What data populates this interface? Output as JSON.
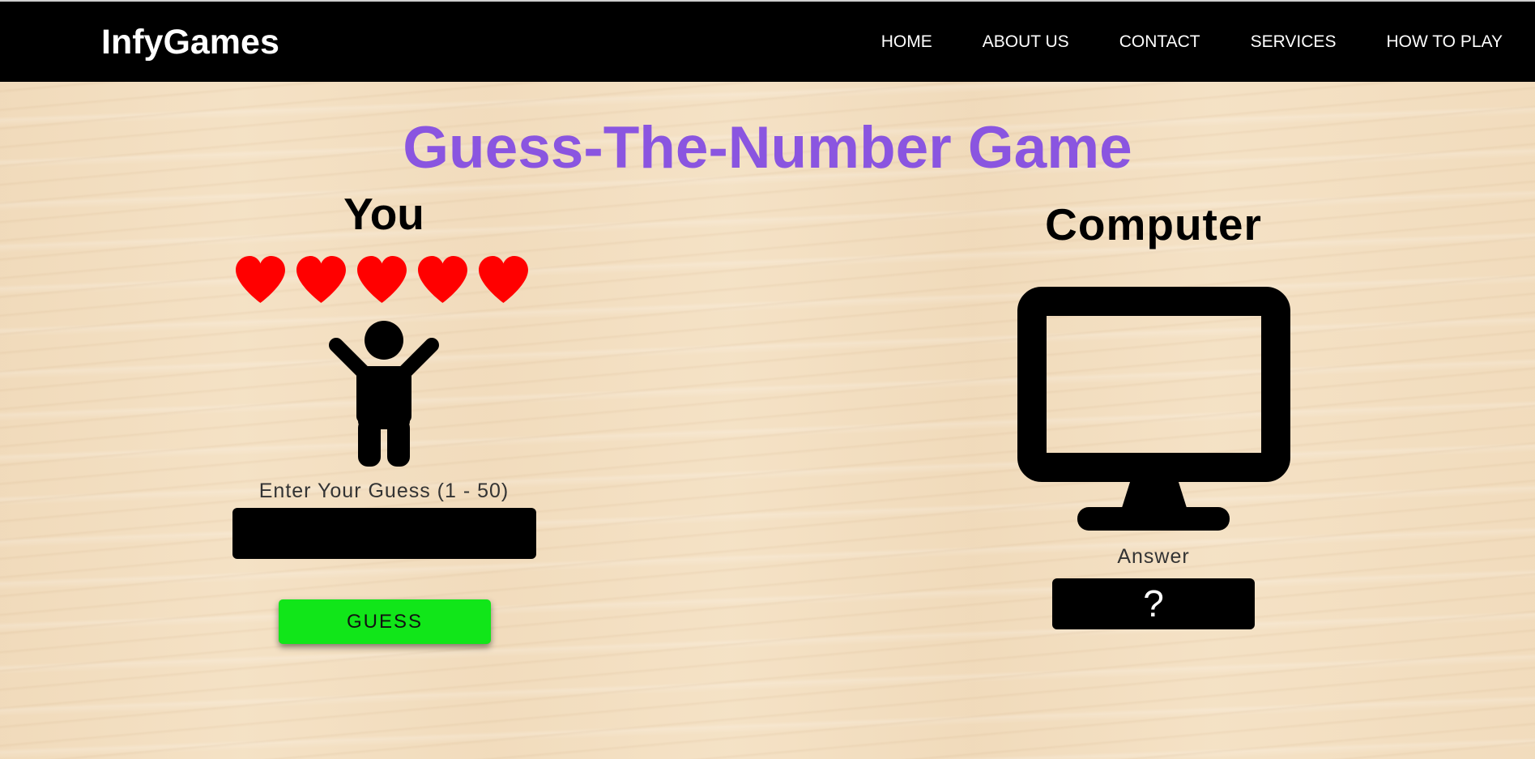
{
  "navbar": {
    "brand": "InfyGames",
    "links": [
      "HOME",
      "ABOUT US",
      "CONTACT",
      "SERVICES",
      "HOW TO PLAY"
    ]
  },
  "title": "Guess-The-Number Game",
  "player": {
    "label": "You",
    "lives": 5,
    "guess_label": "Enter Your Guess (1 - 50)",
    "guess_value": "",
    "guess_button": "GUESS"
  },
  "computer": {
    "label": "Computer",
    "answer_label": "Answer",
    "answer_value": "?"
  },
  "colors": {
    "navbar_bg": "#000000",
    "title": "#8a55e0",
    "heart": "#ff0000",
    "guess_button": "#11e619",
    "background": "#f4e0c2"
  },
  "icons": {
    "lives": "heart-icon",
    "player": "person-icon",
    "computer": "monitor-icon"
  }
}
